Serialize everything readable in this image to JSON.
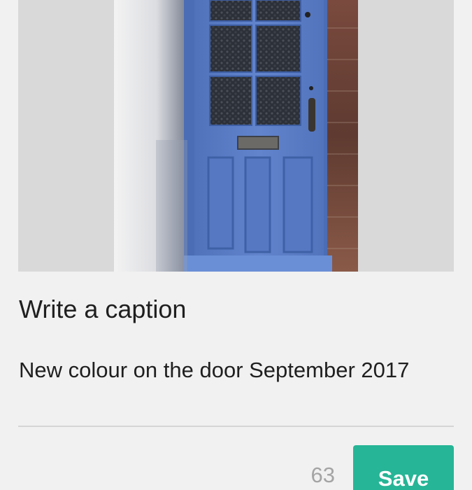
{
  "photo": {
    "subject": "blue-front-door-photo"
  },
  "caption": {
    "heading": "Write a caption",
    "text": "New colour on the door September 2017"
  },
  "footer": {
    "char_count": "63",
    "save_label": "Save"
  },
  "colors": {
    "background": "#f1f1f1",
    "accent": "#26b596",
    "door_blue": "#5b7fc6",
    "divider": "#d5d5d5",
    "counter_text": "#a4a4a4"
  }
}
